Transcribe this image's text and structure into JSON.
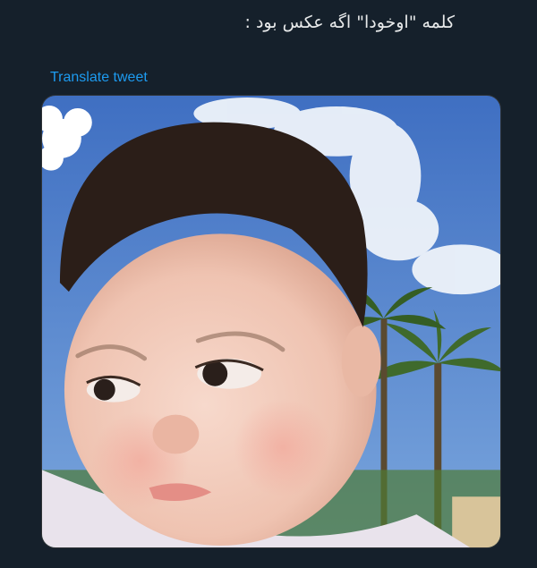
{
  "tweet": {
    "text": "کلمه \"اوخودا\" اگه عکس بود :",
    "translate_label": "Translate tweet"
  },
  "media": {
    "alt": "photo of a pouting baby outdoors under a blue sky with palm trees"
  },
  "colors": {
    "background": "#15202b",
    "text": "#e7e9ea",
    "link": "#1d9bf0"
  }
}
